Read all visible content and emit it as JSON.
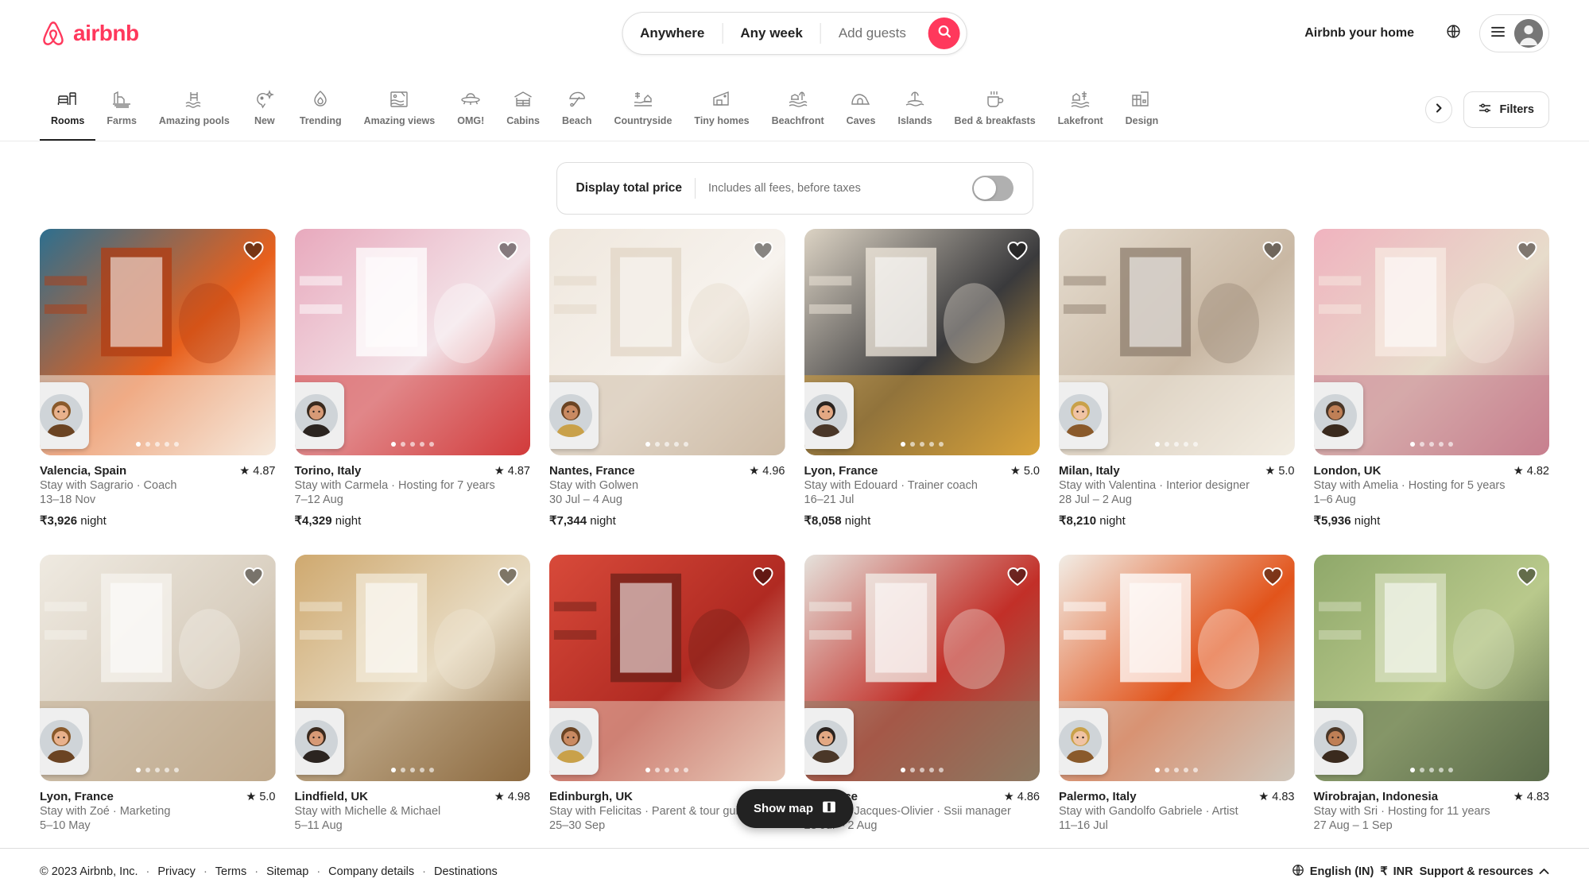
{
  "brand": {
    "name": "airbnb",
    "color": "#FF385C"
  },
  "search": {
    "location": "Anywhere",
    "dates": "Any week",
    "guests": "Add guests",
    "search_icon": "search-icon"
  },
  "header": {
    "host_link": "Airbnb your home",
    "globe_icon": "globe-icon",
    "menu_icon": "hamburger-icon",
    "avatar_icon": "user-avatar-icon"
  },
  "categories": [
    {
      "label": "Rooms",
      "icon": "rooms-icon",
      "active": true
    },
    {
      "label": "Farms",
      "icon": "farms-icon",
      "active": false
    },
    {
      "label": "Amazing pools",
      "icon": "pool-icon",
      "active": false
    },
    {
      "label": "New",
      "icon": "new-sparkle-icon",
      "active": false
    },
    {
      "label": "Trending",
      "icon": "flame-icon",
      "active": false
    },
    {
      "label": "Amazing views",
      "icon": "views-icon",
      "active": false
    },
    {
      "label": "OMG!",
      "icon": "ufo-icon",
      "active": false
    },
    {
      "label": "Cabins",
      "icon": "cabin-icon",
      "active": false
    },
    {
      "label": "Beach",
      "icon": "beach-umbrella-icon",
      "active": false
    },
    {
      "label": "Countryside",
      "icon": "countryside-icon",
      "active": false
    },
    {
      "label": "Tiny homes",
      "icon": "tiny-home-icon",
      "active": false
    },
    {
      "label": "Beachfront",
      "icon": "beachfront-icon",
      "active": false
    },
    {
      "label": "Caves",
      "icon": "cave-icon",
      "active": false
    },
    {
      "label": "Islands",
      "icon": "island-palm-icon",
      "active": false
    },
    {
      "label": "Bed & breakfasts",
      "icon": "coffee-cup-icon",
      "active": false
    },
    {
      "label": "Lakefront",
      "icon": "lakefront-icon",
      "active": false
    },
    {
      "label": "Design",
      "icon": "design-building-icon",
      "active": false
    }
  ],
  "nav_next_icon": "chevron-right-icon",
  "filters": {
    "label": "Filters",
    "icon": "filters-sliders-icon"
  },
  "total_price": {
    "title": "Display total price",
    "subtitle": "Includes all fees, before taxes",
    "toggle_on": false
  },
  "show_map": {
    "label": "Show map",
    "icon": "map-icon"
  },
  "listings": [
    {
      "title": "Valencia, Spain",
      "rating": "4.87",
      "host": "Stay with Sagrario · Coach",
      "dates": "13–18 Nov",
      "price": "₹3,926",
      "unit": "night",
      "dots": 5,
      "active_dot": 0,
      "price_visible": true
    },
    {
      "title": "Torino, Italy",
      "rating": "4.87",
      "host": "Stay with Carmela · Hosting for 7 years",
      "dates": "7–12 Aug",
      "price": "₹4,329",
      "unit": "night",
      "dots": 5,
      "active_dot": 0,
      "price_visible": true
    },
    {
      "title": "Nantes, France",
      "rating": "4.96",
      "host": "Stay with Golwen",
      "dates": "30 Jul – 4 Aug",
      "price": "₹7,344",
      "unit": "night",
      "dots": 5,
      "active_dot": 0,
      "price_visible": true
    },
    {
      "title": "Lyon, France",
      "rating": "5.0",
      "host": "Stay with Edouard · Trainer coach",
      "dates": "16–21 Jul",
      "price": "₹8,058",
      "unit": "night",
      "dots": 5,
      "active_dot": 0,
      "price_visible": true
    },
    {
      "title": "Milan, Italy",
      "rating": "5.0",
      "host": "Stay with Valentina · Interior designer",
      "dates": "28 Jul – 2 Aug",
      "price": "₹8,210",
      "unit": "night",
      "dots": 5,
      "active_dot": 0,
      "price_visible": true
    },
    {
      "title": "London, UK",
      "rating": "4.82",
      "host": "Stay with Amelia · Hosting for 5 years",
      "dates": "1–6 Aug",
      "price": "₹5,936",
      "unit": "night",
      "dots": 5,
      "active_dot": 0,
      "price_visible": true
    },
    {
      "title": "Lyon, France",
      "rating": "5.0",
      "host": "Stay with Zoé · Marketing",
      "dates": "5–10 May",
      "price": "",
      "unit": "",
      "dots": 5,
      "active_dot": 0,
      "price_visible": false
    },
    {
      "title": "Lindfield, UK",
      "rating": "4.98",
      "host": "Stay with Michelle & Michael",
      "dates": "5–11 Aug",
      "price": "",
      "unit": "",
      "dots": 5,
      "active_dot": 0,
      "price_visible": false
    },
    {
      "title": "Edinburgh, UK",
      "rating": "",
      "host": "Stay with Felicitas · Parent & tour guide",
      "dates": "25–30 Sep",
      "price": "",
      "unit": "",
      "dots": 5,
      "active_dot": 0,
      "price_visible": false
    },
    {
      "title": "ff, France",
      "rating": "4.86",
      "host": "Stay with Jacques-Olivier · Ssii manager",
      "dates": "28 Jul – 2 Aug",
      "price": "",
      "unit": "",
      "dots": 5,
      "active_dot": 0,
      "price_visible": false
    },
    {
      "title": "Palermo, Italy",
      "rating": "4.83",
      "host": "Stay with Gandolfo Gabriele · Artist",
      "dates": "11–16 Jul",
      "price": "",
      "unit": "",
      "dots": 5,
      "active_dot": 0,
      "price_visible": false
    },
    {
      "title": "Wirobrajan, Indonesia",
      "rating": "4.83",
      "host": "Stay with Sri · Hosting for 11 years",
      "dates": "27 Aug – 1 Sep",
      "price": "",
      "unit": "",
      "dots": 5,
      "active_dot": 0,
      "price_visible": false
    }
  ],
  "footer": {
    "copyright": "© 2023 Airbnb, Inc.",
    "links": [
      "Privacy",
      "Terms",
      "Sitemap",
      "Company details",
      "Destinations"
    ],
    "language": "English (IN)",
    "currency_symbol": "₹",
    "currency": "INR",
    "support": "Support & resources",
    "globe_icon": "globe-icon",
    "chevron_icon": "chevron-up-icon"
  }
}
